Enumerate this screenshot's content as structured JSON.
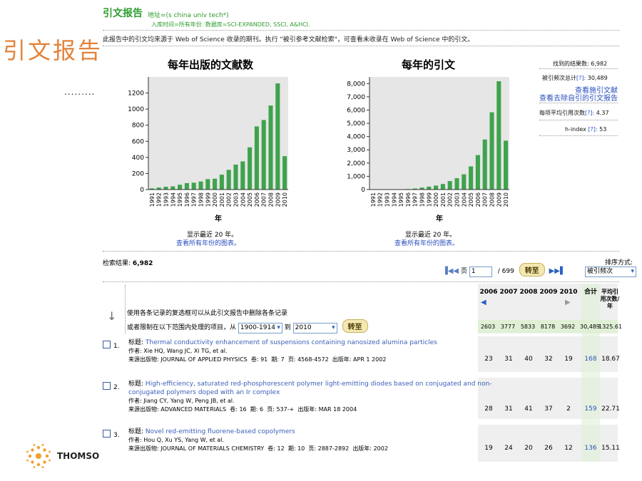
{
  "slide": {
    "title": "引文报告",
    "dots": "........."
  },
  "report": {
    "title": "引文报告",
    "address_line": "地址=(s china univ tech*)",
    "index_line": "入库时间=所有年份. 数据库=SCI-EXPANDED, SSCI, A&HCI.",
    "note": "此报告中的引文均来源于 Web of Science 收录的期刊。执行 \"被引参考文献检索\"，可查看未收录在 Web of Science 中的引文。"
  },
  "charts": {
    "pubs_title": "每年出版的文献数",
    "cites_title": "每年的引文",
    "xlabel": "年",
    "recent_note": "显示最近 20 年。",
    "all_link": "查看所有年份的图表。"
  },
  "chart_data": [
    {
      "type": "bar",
      "title": "每年出版的文献数",
      "xlabel": "年",
      "categories": [
        "1991",
        "1992",
        "1993",
        "1994",
        "1995",
        "1996",
        "1997",
        "1998",
        "1999",
        "2000",
        "2001",
        "2002",
        "2003",
        "2004",
        "2005",
        "2006",
        "2007",
        "2008",
        "2009",
        "2010"
      ],
      "values": [
        15,
        25,
        35,
        40,
        60,
        80,
        85,
        100,
        130,
        135,
        185,
        245,
        310,
        350,
        525,
        785,
        865,
        1045,
        1320,
        415
      ],
      "yticks": [
        "0",
        "200",
        "400",
        "600",
        "800",
        "1000",
        "1200"
      ],
      "ylim": [
        0,
        1400
      ],
      "bar_color": "#3fa34d"
    },
    {
      "type": "bar",
      "title": "每年的引文",
      "xlabel": "年",
      "categories": [
        "1991",
        "1992",
        "1993",
        "1994",
        "1995",
        "1996",
        "1997",
        "1998",
        "1999",
        "2000",
        "2001",
        "2002",
        "2003",
        "2004",
        "2005",
        "2006",
        "2007",
        "2008",
        "2009",
        "2010"
      ],
      "values": [
        0,
        0,
        5,
        10,
        20,
        40,
        80,
        150,
        220,
        300,
        420,
        640,
        860,
        1150,
        1750,
        2603,
        3777,
        5833,
        8178,
        3692
      ],
      "yticks": [
        "0",
        "1,000",
        "2,000",
        "3,000",
        "4,000",
        "5,000",
        "6,000",
        "7,000",
        "8,000"
      ],
      "ylim": [
        0,
        8500
      ],
      "bar_color": "#3fa34d"
    }
  ],
  "stats": {
    "found_label": "找到的结果数:",
    "found_value": "6,982",
    "cited_label": "被引频次总计",
    "cited_value": "30,489",
    "view_citing": "查看施引文献",
    "view_no_self": "查看去除自引的引文报告",
    "avg_label": "每项平均引用次数",
    "avg_value": "4.37",
    "h_label": "h-index",
    "h_value": "53",
    "help": "[?]:"
  },
  "results": {
    "label": "检索结果:",
    "count": "6,982",
    "page_label": "页",
    "page_value": "1",
    "page_total": "/ 699",
    "go": "转至",
    "sort_label": "排序方式:",
    "sort_value": "被引频次"
  },
  "filter": {
    "line1": "使用各条记录的复选框可以从此引文报告中删除各条记录",
    "line2": "或者限制在以下范围内处理的项目，从",
    "from": "1900-1914",
    "to_label": "到",
    "to": "2010",
    "go": "转至"
  },
  "table": {
    "headers": [
      "2006",
      "2007",
      "2008",
      "2009",
      "2010",
      "合计",
      "平均引用次数/年"
    ],
    "totals": [
      "2603",
      "3777",
      "5833",
      "8178",
      "3692",
      "30,489",
      "1325.61"
    ],
    "rows": [
      {
        "num": "1.",
        "title": "Thermal conductivity enhancement of suspensions containing nanosized alumina particles",
        "title2": "",
        "authors": "Xie HQ, Wang JC, Xi TG, et al.",
        "source": "JOURNAL OF APPLIED PHYSICS",
        "vol": "91",
        "issue": "7",
        "pages": "4568-4572",
        "date": "APR 1 2002",
        "cells": [
          "23",
          "31",
          "40",
          "32",
          "19",
          "168",
          "18.67"
        ]
      },
      {
        "num": "2.",
        "title": "High-efficiency, saturated red-phosphorescent polymer light-emitting diodes based on conjugated and non-",
        "title2": "conjugated polymers doped with an Ir complex",
        "authors": "Jiang CY, Yang W, Peng JB, et al.",
        "source": "ADVANCED MATERIALS",
        "vol": "16",
        "issue": "6",
        "pages": "537-+",
        "date": "MAR 18 2004",
        "cells": [
          "28",
          "31",
          "41",
          "37",
          "2",
          "159",
          "22.71"
        ]
      },
      {
        "num": "3.",
        "title": "Novel red-emitting fluorene-based copolymers",
        "title2": "",
        "authors": "Hou Q, Xu YS, Yang W, et al.",
        "source": "JOURNAL OF MATERIALS CHEMISTRY",
        "vol": "12",
        "issue": "10",
        "pages": "2887-2892",
        "date": "2002",
        "cells": [
          "19",
          "24",
          "20",
          "26",
          "12",
          "136",
          "15.11"
        ]
      }
    ],
    "lbl_title": "标题:",
    "lbl_author": "作者:",
    "lbl_source": "来源出版物:",
    "lbl_vol": "卷:",
    "lbl_issue": "期:",
    "lbl_pages": "页:",
    "lbl_date": "出版年:"
  },
  "logo": {
    "text": "THOMSO"
  },
  "colors": {
    "accent_orange": "#e2833a",
    "green": "#2e9c2e",
    "bar": "#3fa34d",
    "link": "#2a4fbf"
  }
}
